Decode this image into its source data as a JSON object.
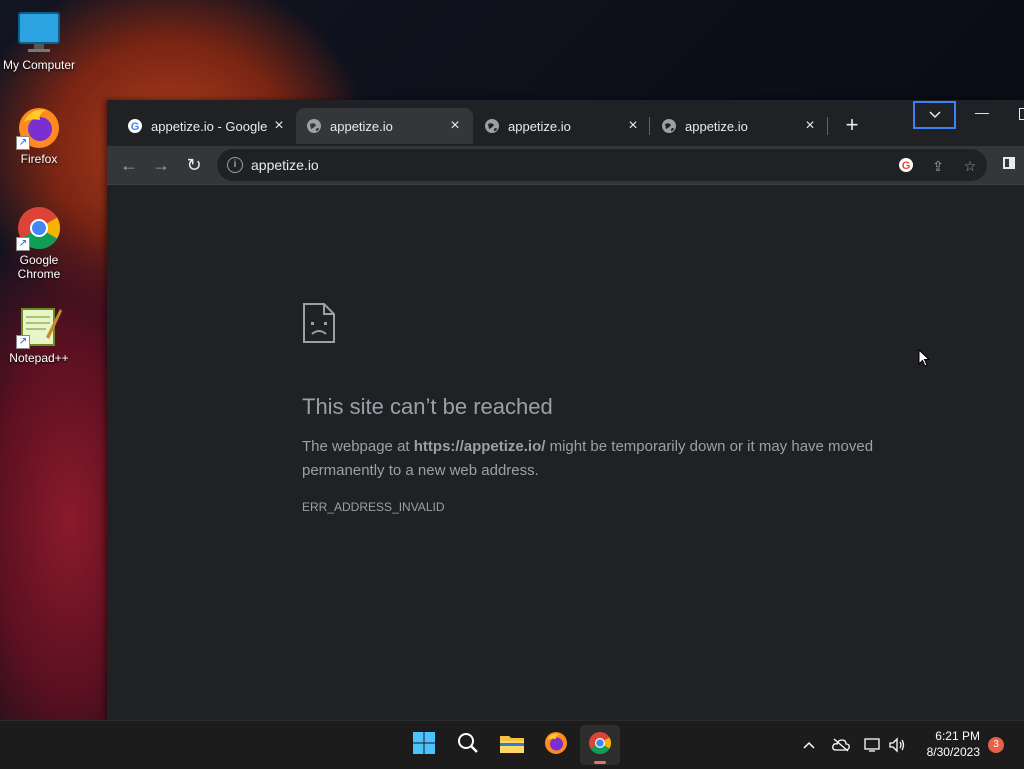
{
  "desktop": {
    "icons": [
      {
        "label": "My Computer"
      },
      {
        "label": "Firefox"
      },
      {
        "label": "Google Chrome"
      },
      {
        "label": "Notepad++"
      }
    ]
  },
  "browser": {
    "tabs": [
      {
        "title": "appetize.io - Google",
        "favicon": "google-g-icon"
      },
      {
        "title": "appetize.io",
        "favicon": "globe-icon",
        "active": true
      },
      {
        "title": "appetize.io",
        "favicon": "globe-icon"
      },
      {
        "title": "appetize.io",
        "favicon": "globe-icon"
      }
    ],
    "omnibox": {
      "url": "appetize.io"
    },
    "error": {
      "title": "This site can’t be reached",
      "desc_prefix": "The webpage at ",
      "desc_url": "https://appetize.io/",
      "desc_suffix": " might be temporarily down or it may have moved permanently to a new web address.",
      "code": "ERR_ADDRESS_INVALID"
    }
  },
  "taskbar": {
    "clock": {
      "time": "6:21 PM",
      "date": "8/30/2023"
    },
    "notification_count": "3"
  },
  "colors": {
    "browser_bg": "#202124",
    "toolbar_bg": "#35363a",
    "text": "#e8eaed",
    "muted_text": "#9aa0a6",
    "focus_ring": "#3b82f6",
    "badge": "#e8604c"
  }
}
